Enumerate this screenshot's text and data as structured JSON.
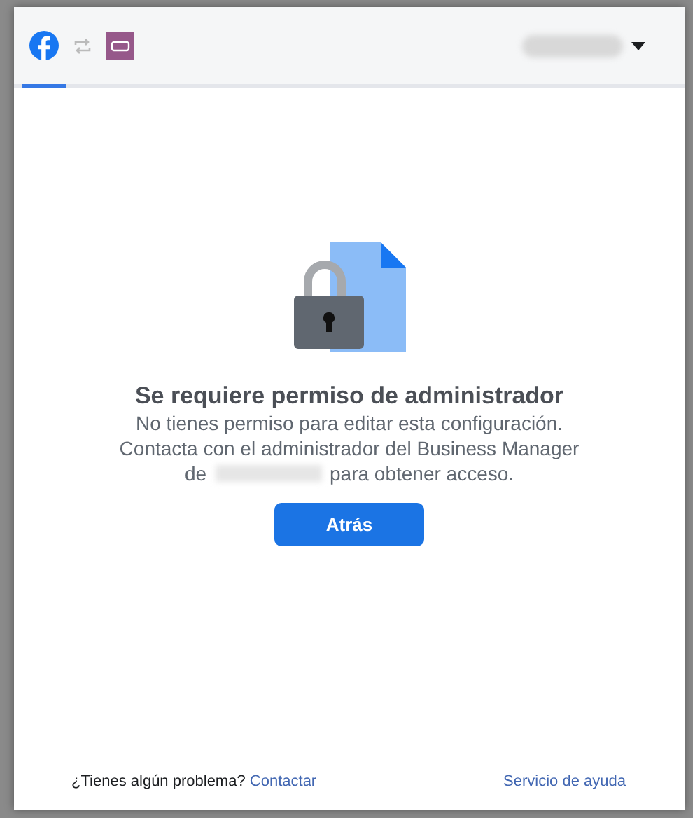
{
  "header": {
    "tabs": [
      {
        "kind": "facebook",
        "selected": true
      },
      {
        "kind": "sync",
        "selected": false
      },
      {
        "kind": "store",
        "selected": false
      }
    ]
  },
  "message": {
    "title": "Se requiere permiso de administrador",
    "lines": [
      "No tienes permiso para editar esta configuración.",
      "Contacta con el administrador del Business Manager"
    ],
    "last_line_before": "de",
    "last_line_after": "para obtener acceso."
  },
  "button": "Atrás",
  "footer": {
    "question": "¿Tienes algún problema?",
    "contact_link": "Contactar",
    "help_link": "Servicio de ayuda"
  }
}
